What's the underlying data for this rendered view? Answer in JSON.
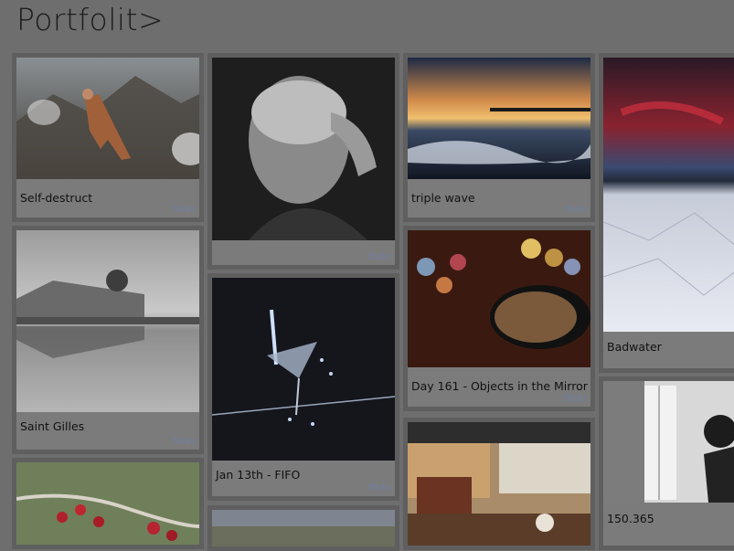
{
  "header": {
    "title": "Portfolit>"
  },
  "photos": {
    "self_destruct": {
      "caption": "Self-destruct",
      "credit": "flickr"
    },
    "old_man": {
      "caption": "",
      "credit": "flickr"
    },
    "triple_wave": {
      "caption": "triple wave",
      "credit": "flickr"
    },
    "badwater": {
      "caption": "Badwater",
      "credit": ""
    },
    "saint_gilles": {
      "caption": "Saint Gilles",
      "credit": "flickr"
    },
    "objects_mirror": {
      "caption": "Day 161 - Objects in the Mirror",
      "credit": "flickr"
    },
    "fifo": {
      "caption": "Jan 13th - FIFO",
      "credit": "flickr"
    },
    "number_150": {
      "caption": "150.365",
      "credit": ""
    },
    "berries": {
      "caption": "",
      "credit": ""
    },
    "cafe": {
      "caption": "",
      "credit": ""
    },
    "bottom_partial": {
      "caption": "",
      "credit": ""
    }
  }
}
